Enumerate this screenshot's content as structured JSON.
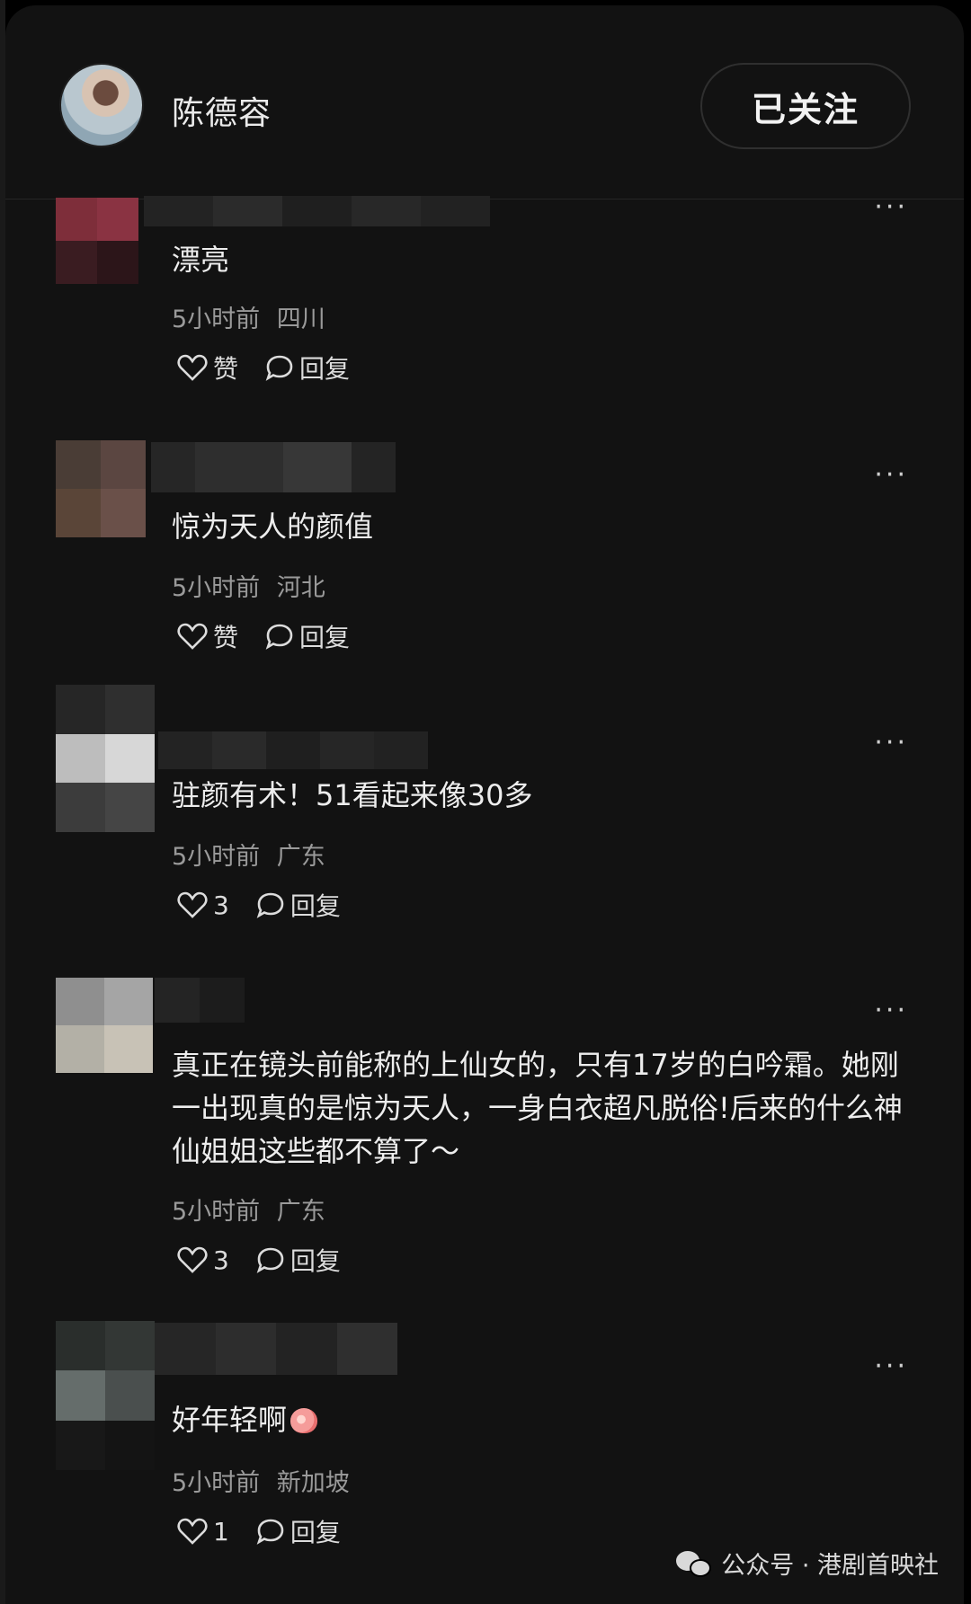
{
  "header": {
    "author_name": "陈德容",
    "follow_label": "已关注"
  },
  "comments": [
    {
      "text": "漂亮",
      "time": "5小时前",
      "location": "四川",
      "like_label": "赞",
      "reply_label": "回复"
    },
    {
      "text": "惊为天人的颜值",
      "time": "5小时前",
      "location": "河北",
      "like_label": "赞",
      "reply_label": "回复"
    },
    {
      "text": "驻颜有术！51看起来像30多",
      "time": "5小时前",
      "location": "广东",
      "like_label": "3",
      "reply_label": "回复"
    },
    {
      "text": "真正在镜头前能称的上仙女的，只有17岁的白吟霜。她刚一出现真的是惊为天人，一身白衣超凡脱俗!后来的什么神仙姐姐这些都不算了～",
      "time": "5小时前",
      "location": "广东",
      "like_label": "3",
      "reply_label": "回复"
    },
    {
      "text": "好年轻啊",
      "time": "5小时前",
      "location": "新加坡",
      "like_label": "1",
      "reply_label": "回复",
      "emoji": "peach-emoji"
    }
  ],
  "more_icon": "···",
  "watermark": {
    "icon": "wechat-icon",
    "text": "公众号 · 港剧首映社"
  }
}
